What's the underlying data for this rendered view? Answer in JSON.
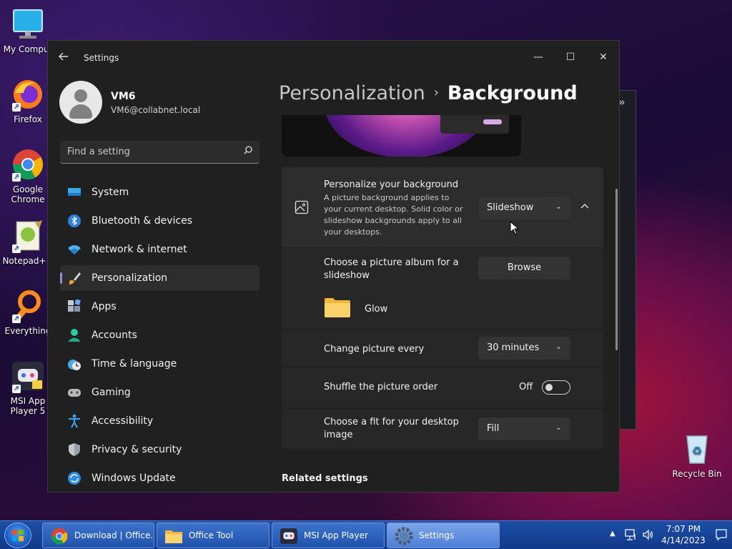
{
  "desktop": {
    "icons": [
      {
        "label": "My Comput",
        "icon": "monitor-icon"
      },
      {
        "label": "Firefox",
        "icon": "firefox-icon"
      },
      {
        "label": "Google Chrome",
        "icon": "chrome-icon"
      },
      {
        "label": "Notepad++",
        "icon": "notepad-plus-plus-icon"
      },
      {
        "label": "Everything",
        "icon": "everything-search-icon"
      },
      {
        "label": "MSI App Player 5",
        "icon": "msi-app-player-icon"
      },
      {
        "label": "Recycle Bin",
        "icon": "recycle-bin-icon"
      }
    ]
  },
  "window": {
    "title": "Settings",
    "controls": {
      "minimize": "—",
      "maximize": "☐",
      "close": "✕"
    }
  },
  "profile": {
    "name": "VM6",
    "email": "VM6@collabnet.local"
  },
  "search": {
    "placeholder": "Find a setting"
  },
  "nav": [
    {
      "label": "System",
      "icon": "system-display-icon"
    },
    {
      "label": "Bluetooth & devices",
      "icon": "bluetooth-icon"
    },
    {
      "label": "Network & internet",
      "icon": "wifi-icon"
    },
    {
      "label": "Personalization",
      "icon": "paintbrush-icon",
      "active": true
    },
    {
      "label": "Apps",
      "icon": "apps-icon"
    },
    {
      "label": "Accounts",
      "icon": "accounts-icon"
    },
    {
      "label": "Time & language",
      "icon": "clock-globe-icon"
    },
    {
      "label": "Gaming",
      "icon": "gamepad-icon"
    },
    {
      "label": "Accessibility",
      "icon": "accessibility-icon"
    },
    {
      "label": "Privacy & security",
      "icon": "shield-icon"
    },
    {
      "label": "Windows Update",
      "icon": "update-icon"
    }
  ],
  "breadcrumb": {
    "parent": "Personalization",
    "separator": "›",
    "current": "Background"
  },
  "personalize": {
    "title": "Personalize your background",
    "description": "A picture background applies to your current desktop. Solid color or slideshow backgrounds apply to all your desktops.",
    "value": "Slideshow"
  },
  "album": {
    "title": "Choose a picture album for a slideshow",
    "button": "Browse",
    "folder_name": "Glow"
  },
  "change_picture": {
    "title": "Change picture every",
    "value": "30 minutes"
  },
  "shuffle": {
    "title": "Shuffle the picture order",
    "state_label": "Off"
  },
  "fit": {
    "title": "Choose a fit for your desktop image",
    "value": "Fill"
  },
  "related": {
    "title": "Related settings"
  },
  "taskbar": {
    "buttons": [
      {
        "label": "Download | Office...",
        "icon": "chrome-icon"
      },
      {
        "label": "Office Tool",
        "icon": "folder-icon"
      },
      {
        "label": "MSI App Player",
        "icon": "msi-app-player-icon"
      },
      {
        "label": "Settings",
        "icon": "settings-gear-icon",
        "active": true
      }
    ],
    "time": "7:07 PM",
    "date": "4/14/2023"
  },
  "colors": {
    "accent": "#9f87e0",
    "window_bg": "#202020",
    "card_bg": "#2b2b2b",
    "taskbar": "#1c4fa5"
  }
}
